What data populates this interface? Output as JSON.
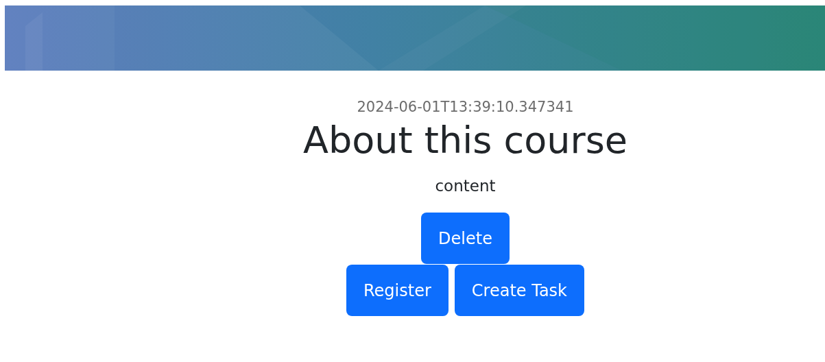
{
  "timestamp": "2024-06-01T13:39:10.347341",
  "title": "About this course",
  "content": "content",
  "button_rows": [
    {
      "buttons": [
        {
          "label": "Delete"
        }
      ]
    },
    {
      "buttons": [
        {
          "label": "Register"
        },
        {
          "label": "Create Task"
        }
      ]
    }
  ]
}
